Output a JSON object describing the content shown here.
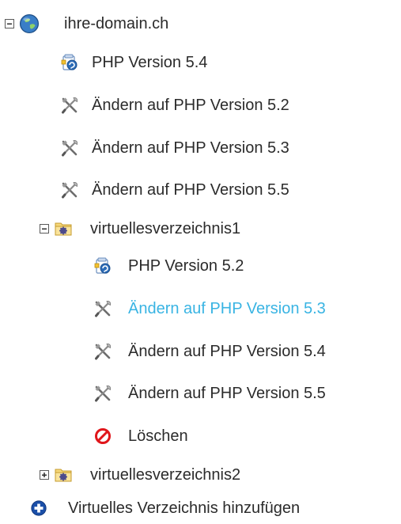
{
  "colors": {
    "text": "#2b2b2b",
    "hover_link": "#39b4e3",
    "delete_red": "#e0161b",
    "add_blue": "#1b4fa8"
  },
  "tree": {
    "root": {
      "label": "ihre-domain.ch",
      "icon": "globe-icon",
      "expanded": true,
      "items": [
        {
          "label": "PHP Version 5.4",
          "icon": "php-version-icon"
        },
        {
          "label": "Ändern auf PHP Version 5.2",
          "icon": "tools-icon"
        },
        {
          "label": "Ändern auf PHP Version 5.3",
          "icon": "tools-icon"
        },
        {
          "label": "Ändern auf PHP Version 5.5",
          "icon": "tools-icon"
        }
      ],
      "dirs": [
        {
          "label": "virtuellesverzeichnis1",
          "icon": "folder-gear-icon",
          "expanded": true,
          "items": [
            {
              "label": "PHP Version 5.2",
              "icon": "php-version-icon"
            },
            {
              "label": "Ändern auf PHP Version 5.3",
              "icon": "tools-icon",
              "hovered": true
            },
            {
              "label": "Ändern auf PHP Version 5.4",
              "icon": "tools-icon"
            },
            {
              "label": "Ändern auf PHP Version 5.5",
              "icon": "tools-icon"
            },
            {
              "label": "Löschen",
              "icon": "delete-icon"
            }
          ]
        },
        {
          "label": "virtuellesverzeichnis2",
          "icon": "folder-gear-icon",
          "expanded": false
        }
      ]
    },
    "add_directory": {
      "label": "Virtuelles Verzeichnis hinzufügen",
      "icon": "add-icon"
    }
  }
}
